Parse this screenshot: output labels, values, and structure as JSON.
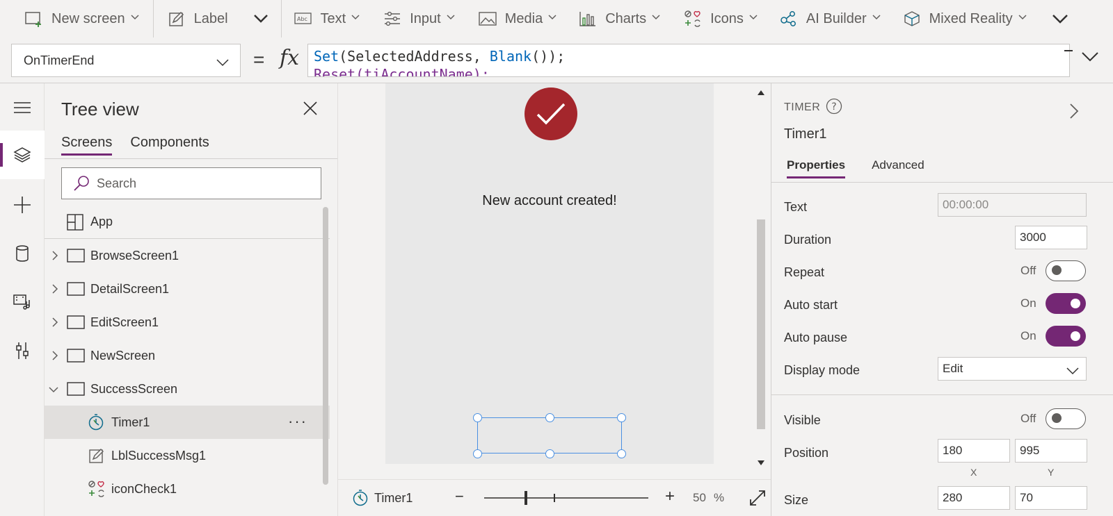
{
  "toolbar": {
    "items": [
      {
        "label": "New screen",
        "icon": "new-screen-icon",
        "chevron": true
      },
      {
        "label": "Label",
        "icon": "label-icon",
        "chevron": false
      },
      {
        "label": "Text",
        "icon": "text-icon",
        "chevron": true
      },
      {
        "label": "Input",
        "icon": "input-icon",
        "chevron": true
      },
      {
        "label": "Media",
        "icon": "media-icon",
        "chevron": true
      },
      {
        "label": "Charts",
        "icon": "charts-icon",
        "chevron": true
      },
      {
        "label": "Icons",
        "icon": "icons-icon",
        "chevron": true
      },
      {
        "label": "AI Builder",
        "icon": "ai-builder-icon",
        "chevron": true
      },
      {
        "label": "Mixed Reality",
        "icon": "mixed-reality-icon",
        "chevron": true
      }
    ]
  },
  "formula": {
    "property": "OnTimerEnd",
    "line1": {
      "fn": "Set",
      "args": "(SelectedAddress, ",
      "fn2": "Blank",
      "rest": "());"
    },
    "line2": {
      "fn": "Reset",
      "rest": "(tiAccountName);"
    }
  },
  "tree": {
    "title": "Tree view",
    "tabs": [
      "Screens",
      "Components"
    ],
    "search_placeholder": "Search",
    "items": [
      {
        "label": "App",
        "type": "app",
        "indent": 0
      },
      {
        "label": "BrowseScreen1",
        "type": "screen",
        "indent": 0,
        "expand": "collapsed"
      },
      {
        "label": "DetailScreen1",
        "type": "screen",
        "indent": 0,
        "expand": "collapsed"
      },
      {
        "label": "EditScreen1",
        "type": "screen",
        "indent": 0,
        "expand": "collapsed"
      },
      {
        "label": "NewScreen",
        "type": "screen",
        "indent": 0,
        "expand": "collapsed"
      },
      {
        "label": "SuccessScreen",
        "type": "screen",
        "indent": 0,
        "expand": "expanded"
      },
      {
        "label": "Timer1",
        "type": "timer",
        "indent": 1,
        "selected": true
      },
      {
        "label": "LblSuccessMsg1",
        "type": "label",
        "indent": 1
      },
      {
        "label": "iconCheck1",
        "type": "icon",
        "indent": 1
      }
    ]
  },
  "canvas": {
    "message": "New account created!"
  },
  "status": {
    "selected": "Timer1",
    "zoom": "50",
    "zoom_unit": "%"
  },
  "props": {
    "kind": "TIMER",
    "name": "Timer1",
    "tabs": [
      "Properties",
      "Advanced"
    ],
    "text_label": "Text",
    "text_value": "00:00:00",
    "duration_label": "Duration",
    "duration_value": "3000",
    "repeat_label": "Repeat",
    "repeat_state": "Off",
    "autostart_label": "Auto start",
    "autostart_state": "On",
    "autopause_label": "Auto pause",
    "autopause_state": "On",
    "displaymode_label": "Display mode",
    "displaymode_value": "Edit",
    "visible_label": "Visible",
    "visible_state": "Off",
    "position_label": "Position",
    "position_x": "180",
    "position_y": "995",
    "axis_x": "X",
    "axis_y": "Y",
    "size_label": "Size",
    "size_w": "280",
    "size_h": "70"
  },
  "colors": {
    "accent": "#742774",
    "check_bg": "#a4262c",
    "selection": "#4a90e2"
  }
}
